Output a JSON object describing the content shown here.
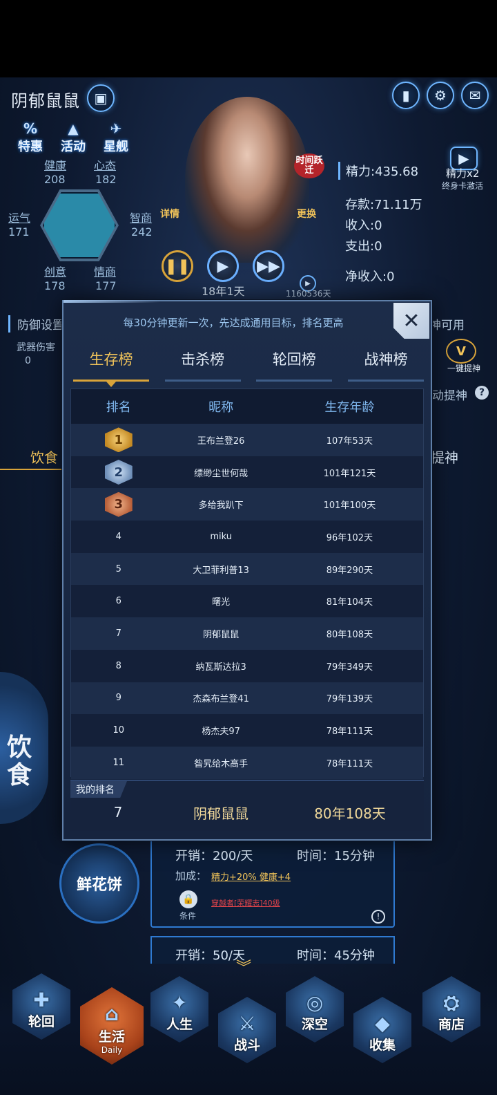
{
  "header": {
    "player_name": "阴郁鼠鼠",
    "quick_links": [
      "特惠",
      "活动",
      "星舰"
    ],
    "icons": [
      "briefcase-icon",
      "chart-icon",
      "gear-icon",
      "mail-icon"
    ]
  },
  "stats": {
    "health": {
      "label": "健康",
      "value": "208"
    },
    "mood": {
      "label": "心态",
      "value": "182"
    },
    "luck": {
      "label": "运气",
      "value": "171"
    },
    "intellect": {
      "label": "智商",
      "value": "242"
    },
    "creativity": {
      "label": "创意",
      "value": "178"
    },
    "emotion": {
      "label": "情商",
      "value": "177"
    }
  },
  "portrait": {
    "time_jump": "时间跃迁",
    "details": "详情",
    "swap": "更换"
  },
  "resources": {
    "energy": "精力:435.68",
    "energy_boost": "精力x2",
    "lifetime_card": "终身卡激活",
    "savings": "存款:71.11万",
    "income": "收入:0",
    "expense": "支出:0",
    "net_income": "净收入:0"
  },
  "time": {
    "age": "18年1天",
    "days_counter": "1160536天"
  },
  "background_partial": {
    "defense": "防御设置",
    "weapon_damage": "武器伤害",
    "weapon_value": "0",
    "god_available": "神可用",
    "one_click": "一键提神",
    "auto_refresh": "动提神",
    "food_tab": "饮食",
    "refresh_tab": "提神",
    "food_big": "饮食"
  },
  "food_card": {
    "name": "鲜花饼",
    "cost": "开销：200/天",
    "time": "时间：15分钟",
    "bonus_label": "加成：",
    "bonus_values": "精力+20%  健康+4",
    "condition_label": "条件",
    "condition_text": "穿越者[荣耀志]40级",
    "next_cost": "开销：50/天",
    "next_time": "时间：45分钟"
  },
  "bottom_nav": [
    {
      "label": "轮回",
      "icon": "cross-emblem-icon"
    },
    {
      "label": "生活",
      "sub": "Daily",
      "icon": "house-emblem-icon",
      "active": true
    },
    {
      "label": "人生",
      "icon": "star-emblem-icon"
    },
    {
      "label": "战斗",
      "icon": "sword-emblem-icon"
    },
    {
      "label": "深空",
      "icon": "planet-emblem-icon"
    },
    {
      "label": "收集",
      "icon": "crystal-emblem-icon"
    },
    {
      "label": "商店",
      "icon": "cart-emblem-icon"
    }
  ],
  "leaderboard": {
    "notice": "每30分钟更新一次，先达成通用目标，排名更高",
    "close": "✕",
    "tabs": [
      "生存榜",
      "击杀榜",
      "轮回榜",
      "战神榜"
    ],
    "active_tab": 0,
    "columns": [
      "排名",
      "昵称",
      "生存年龄"
    ],
    "rows": [
      {
        "rank": "1",
        "name": "王布兰登26",
        "age": "107年53天"
      },
      {
        "rank": "2",
        "name": "缥缈尘世何哉",
        "age": "101年121天"
      },
      {
        "rank": "3",
        "name": "多给我趴下",
        "age": "101年100天"
      },
      {
        "rank": "4",
        "name": "miku",
        "age": "96年102天"
      },
      {
        "rank": "5",
        "name": "大卫菲利普13",
        "age": "89年290天"
      },
      {
        "rank": "6",
        "name": "曙光",
        "age": "81年104天"
      },
      {
        "rank": "7",
        "name": "阴郁鼠鼠",
        "age": "80年108天"
      },
      {
        "rank": "8",
        "name": "纳瓦斯达拉3",
        "age": "79年349天"
      },
      {
        "rank": "9",
        "name": "杰森布兰登41",
        "age": "79年139天"
      },
      {
        "rank": "10",
        "name": "杨杰夫97",
        "age": "78年111天"
      },
      {
        "rank": "11",
        "name": "昝旯给木高手",
        "age": "78年111天"
      }
    ],
    "my_rank_label": "我的排名",
    "my_rank": {
      "rank": "7",
      "name": "阴郁鼠鼠",
      "age": "80年108天"
    }
  },
  "colors": {
    "gold": "#d9a43a",
    "accent_blue": "#6fb6ff",
    "panel": "#1c2c49"
  }
}
